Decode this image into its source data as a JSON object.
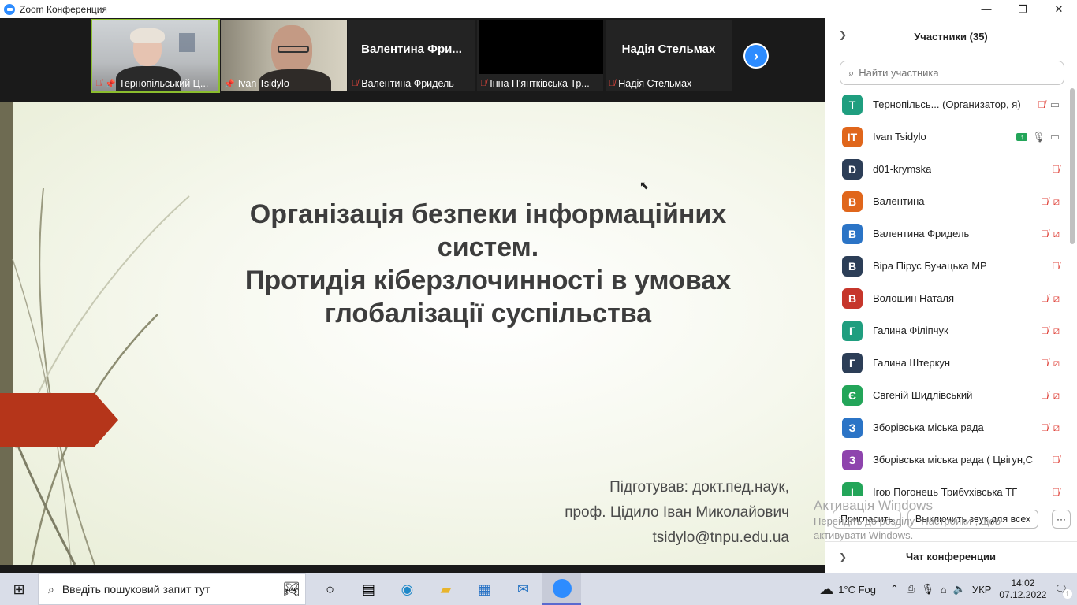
{
  "window": {
    "title": "Zoom Конференция",
    "controls": [
      "—",
      "❐",
      "✕"
    ]
  },
  "video_strip": {
    "tiles": [
      {
        "caption": "Тернопільський Ц...",
        "big_name": "",
        "muted": true,
        "pinned": true,
        "active": true
      },
      {
        "caption": "Ivan Tsidylo",
        "big_name": "",
        "muted": false,
        "pinned": true,
        "active": false
      },
      {
        "caption": "Валентина Фридель",
        "big_name": "Валентина  Фри...",
        "muted": true,
        "pinned": false,
        "active": false
      },
      {
        "caption": "Інна П'янтківська Тр...",
        "big_name": "",
        "muted": true,
        "pinned": false,
        "active": false
      },
      {
        "caption": "Надія Стельмах",
        "big_name": "Надія Стельмах",
        "muted": true,
        "pinned": false,
        "active": false
      }
    ],
    "next_label": "›"
  },
  "slide": {
    "heading_line1": "Організація безпеки інформаційних систем.",
    "heading_line2": "Протидія кіберзлочинності в умовах глобалізації суспільства",
    "author_line1": "Підготував: докт.пед.наук,",
    "author_line2": "проф. Цідило Іван Миколайович",
    "author_line3": "tsidylo@tnpu.edu.ua"
  },
  "participants_panel": {
    "title": "Участники (35)",
    "search_placeholder": "Найти участника",
    "participants": [
      {
        "initial": "T",
        "name": "Тернопільсь...  (Организатор, я)",
        "color": "#1f9e7f",
        "mic": "off",
        "video": "on",
        "share": false
      },
      {
        "initial": "IT",
        "name": "Ivan Tsidylo",
        "color": "#e0661b",
        "mic": "on",
        "video": "on",
        "share": true
      },
      {
        "initial": "D",
        "name": "d01-krymska",
        "color": "#2c3e57",
        "mic": "off",
        "video": "none",
        "share": false
      },
      {
        "initial": "В",
        "name": "Валентина",
        "color": "#e0661b",
        "mic": "off",
        "video": "off",
        "share": false
      },
      {
        "initial": "В",
        "name": "Валентина Фридель",
        "color": "#2b74c6",
        "mic": "off",
        "video": "off",
        "share": false
      },
      {
        "initial": "В",
        "name": "Віра Пірус Бучацька МР",
        "color": "#2c3e57",
        "mic": "off",
        "video": "none",
        "share": false
      },
      {
        "initial": "В",
        "name": "Волошин Наталя",
        "color": "#c6362b",
        "mic": "off",
        "video": "off",
        "share": false
      },
      {
        "initial": "Г",
        "name": "Галина Філіпчук",
        "color": "#1f9e7f",
        "mic": "off",
        "video": "off",
        "share": false
      },
      {
        "initial": "Г",
        "name": "Галина Штеркун",
        "color": "#2c3e57",
        "mic": "off",
        "video": "off",
        "share": false
      },
      {
        "initial": "Є",
        "name": "Євгеній Шидлівський",
        "color": "#23a559",
        "mic": "off",
        "video": "off",
        "share": false
      },
      {
        "initial": "З",
        "name": "Зборівська міська рада",
        "color": "#2b74c6",
        "mic": "off",
        "video": "off",
        "share": false
      },
      {
        "initial": "З",
        "name": "Зборівська міська рада ( Цвігун,С...",
        "color": "#8e44ad",
        "mic": "off",
        "video": "none",
        "share": false
      },
      {
        "initial": "І",
        "name": "Ігор Погонець Трибухівська ТГ",
        "color": "#23a559",
        "mic": "off",
        "video": "none",
        "share": false
      }
    ],
    "invite_label": "Пригласить",
    "mute_all_label": "Выключить звук для всех",
    "more_label": "···",
    "chat_title": "Чат конференции"
  },
  "activation": {
    "title": "Активація Windows",
    "line1": "Перейдіть до розділу \"Настройки\", щоб",
    "line2": "активувати Windows."
  },
  "taskbar": {
    "search_placeholder": "Введіть пошуковий запит тут",
    "weather": "1°C  Fog",
    "language": "УКР",
    "time": "14:02",
    "date": "07.12.2022",
    "notifications": "1"
  }
}
